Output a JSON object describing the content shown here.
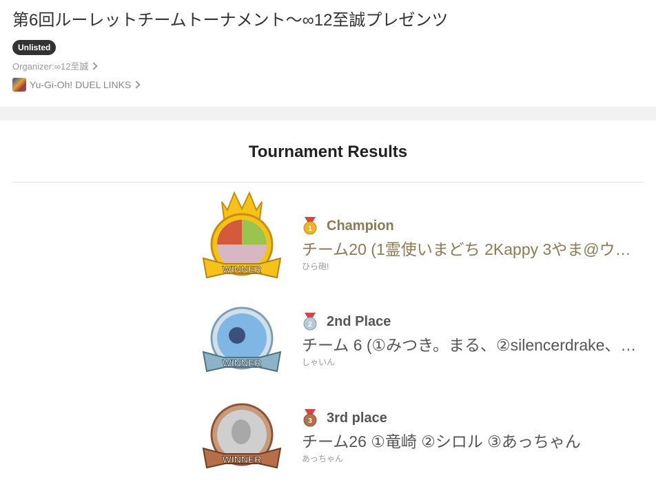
{
  "tournament": {
    "title": "第6回ルーレットチームトーナメント〜∞12至誠プレゼンツ",
    "visibility_badge": "Unlisted",
    "organizer": "Organizer:∞12至誠",
    "game": "Yu-Gi-Oh! DUEL LINKS"
  },
  "results": {
    "heading": "Tournament Results",
    "medal_label": "WINNER",
    "entries": [
      {
        "place_label": "Champion",
        "place_number": "1",
        "team": "チーム20 (1霊使いまどち 2Kappy 3やま@ウェ…",
        "leader": "ひら砲!",
        "accent": "#f0b323"
      },
      {
        "place_label": "2nd Place",
        "place_number": "2",
        "team": "チーム 6 (①みつき。まる、②silencerdrake、③…",
        "leader": "しゃいん",
        "accent": "#8fb3c6"
      },
      {
        "place_label": "3rd place",
        "place_number": "3",
        "team": "チーム26 ①竜崎 ②シロル ③あっちゃん",
        "leader": "あっちゃん",
        "accent": "#b5704a"
      }
    ]
  },
  "colors": {
    "gold": "#f0b323",
    "silver": "#8fb3c6",
    "bronze": "#b5704a",
    "badge_bg": "#333333"
  }
}
